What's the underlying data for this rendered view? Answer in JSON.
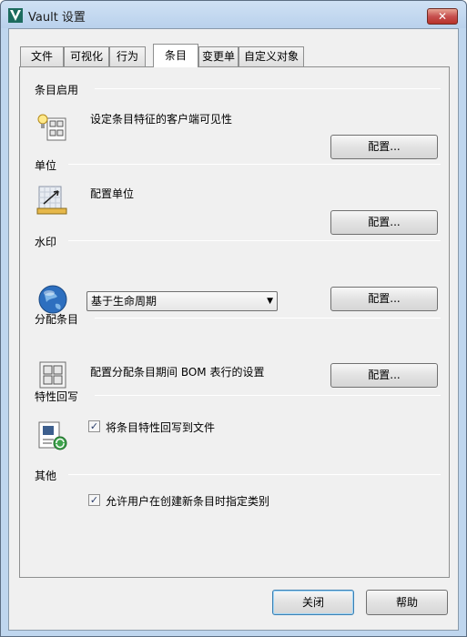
{
  "window": {
    "title": "Vault 设置",
    "close_glyph": "✕"
  },
  "tabs": [
    {
      "label": "文件"
    },
    {
      "label": "可视化"
    },
    {
      "label": "行为"
    },
    {
      "label": "条目",
      "active": true
    },
    {
      "label": "变更单"
    },
    {
      "label": "自定义对象"
    }
  ],
  "sections": {
    "item_enable": {
      "title": "条目启用",
      "desc": "设定条目特征的客户端可见性",
      "button": "配置...",
      "icon": "lightbulb-grid-icon"
    },
    "units": {
      "title": "单位",
      "desc": "配置单位",
      "button": "配置...",
      "icon": "ruler-units-icon"
    },
    "watermark": {
      "title": "水印",
      "selected": "基于生命周期",
      "button": "配置...",
      "icon": "globe-icon"
    },
    "assign_items": {
      "title": "分配条目",
      "desc": "配置分配条目期间 BOM 表行的设置",
      "button": "配置...",
      "icon": "grid-icon"
    },
    "writeback": {
      "title": "特性回写",
      "checkbox_label": "将条目特性回写到文件",
      "checked": true,
      "icon": "writeback-icon"
    },
    "other": {
      "title": "其他",
      "checkbox_label": "允许用户在创建新条目时指定类别",
      "checked": true
    }
  },
  "footer": {
    "close_label": "关闭",
    "help_label": "帮助"
  },
  "colors": {
    "title_bar": "#c4d9f0",
    "close_button": "#c75050",
    "panel": "#f0f0f0"
  }
}
